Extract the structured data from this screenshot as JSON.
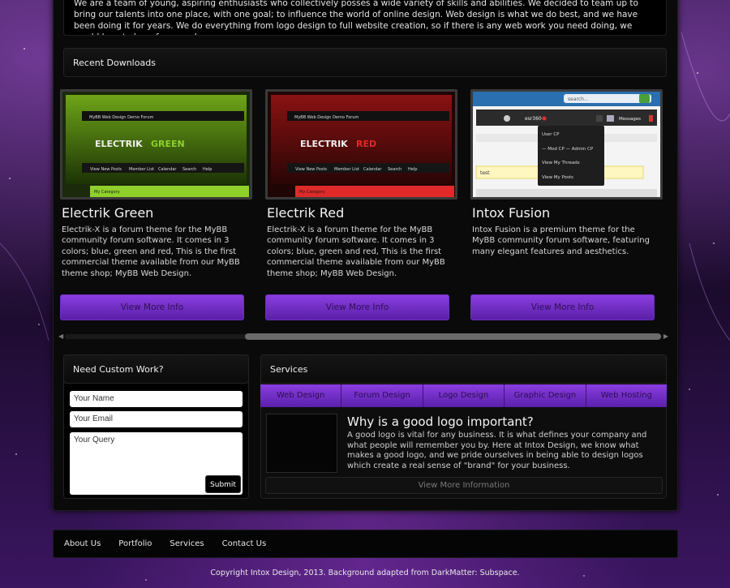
{
  "intro": {
    "text": "We are a team of young, aspiring enthusiasts who collectively posses a wide variety of skills and abilities. We decided to team up to bring our talents into one place, with one goal; to influence the world of online design. Web design is what we do best, and we have been doing it for years. We do everything from logo design to full website creation, so if there is any web work you need doing, we would love to hear from you!"
  },
  "downloads": {
    "heading": "Recent Downloads",
    "items": [
      {
        "title": "Electrik Green",
        "description": "Electrik-X is a forum theme for the MyBB community forum software. It comes in 3 colors; blue, green and red, This is the first commercial theme available from our MyBB theme shop; MyBB Web Design.",
        "button": "View More Info",
        "thumb": {
          "forum_label": "MyBB Web Design Demo Forum",
          "logo_a": "ELECTRIK",
          "logo_b": "GREEN",
          "nav": [
            "View New Posts",
            "Member List",
            "Calendar",
            "Search",
            "Help"
          ],
          "category": "My Category",
          "accent": "#8fd12a"
        }
      },
      {
        "title": "Electrik Red",
        "description": "Electrik-X is a forum theme for the MyBB community forum software. It comes in 3 colors; blue, green and red, This is the first commercial theme available from our MyBB theme shop; MyBB Web Design.",
        "button": "View More Info",
        "thumb": {
          "forum_label": "MyBB Web Design Demo Forum",
          "logo_a": "ELECTRIK",
          "logo_b": "RED",
          "nav": [
            "View New Posts",
            "Member List",
            "Calendar",
            "Search",
            "Help"
          ],
          "category": "My Category",
          "accent": "#e02a2a"
        }
      },
      {
        "title": "Intox Fusion",
        "description": "Intox Fusion is a premium theme for the MyBB community forum software, featuring many elegant features and aesthetics.",
        "button": "View More Info",
        "thumb": {
          "search": "search...",
          "user": "esr360",
          "messages": "Messages",
          "menu": [
            "User CP",
            "— Mod CP — Admin CP",
            "View My Threads",
            "View My Posts"
          ],
          "notice": "test"
        }
      }
    ]
  },
  "contact": {
    "heading": "Need Custom Work?",
    "name_placeholder": "Your Name",
    "email_placeholder": "Your Email",
    "query_placeholder": "Your Query",
    "submit": "Submit"
  },
  "services": {
    "heading": "Services",
    "tabs": [
      "Web Design",
      "Forum Design",
      "Logo Design",
      "Graphic Design",
      "Web Hosting"
    ],
    "title": "Why is a good logo important?",
    "text": "A good logo is vital for any business. It is what defines your company and what people will remember you by. Here at Intox Design, we know what makes a good logo, and we pride ourselves in being able to design logos which create a real sense of \"brand\" for your business.",
    "more": "View More Information"
  },
  "footer": {
    "links": [
      "About Us",
      "Portfolio",
      "Services",
      "Contact Us"
    ],
    "copyright": "Copyright Intox Design, 2013. Background adapted from DarkMatter: Subspace."
  },
  "colors": {
    "accent_purple": "#7a34d0",
    "background": "#1b0b2c"
  }
}
